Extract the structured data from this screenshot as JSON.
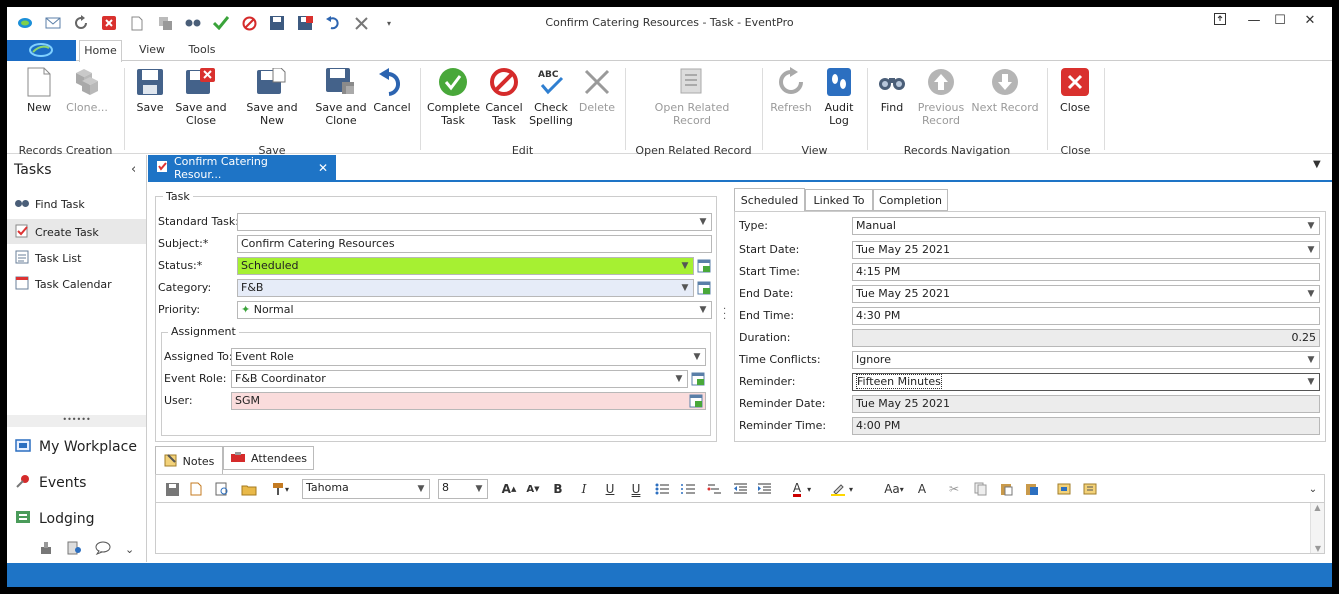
{
  "window": {
    "title": "Confirm Catering Resources - Task - EventPro"
  },
  "ribbon": {
    "tabs": [
      {
        "label": "Home"
      },
      {
        "label": "View"
      },
      {
        "label": "Tools"
      }
    ],
    "buttons": {
      "new": "New",
      "clone": "Clone...",
      "save": "Save",
      "save_close": "Save and\nClose",
      "save_new": "Save and New",
      "save_clone": "Save and\nClone",
      "cancel": "Cancel",
      "complete": "Complete\nTask",
      "cancel_task": "Cancel\nTask",
      "check_spelling": "Check\nSpelling",
      "delete": "Delete",
      "open_related": "Open Related\nRecord",
      "refresh": "Refresh",
      "audit_log": "Audit\nLog",
      "find": "Find",
      "prev_record": "Previous\nRecord",
      "next_record": "Next Record",
      "close": "Close"
    },
    "groups": {
      "records_creation": "Records Creation",
      "save": "Save",
      "edit": "Edit",
      "open_related": "Open Related Record",
      "view": "View",
      "records_navigation": "Records Navigation",
      "close": "Close"
    }
  },
  "sidebar": {
    "title": "Tasks",
    "items": [
      {
        "label": "Find Task"
      },
      {
        "label": "Create Task"
      },
      {
        "label": "Task List"
      },
      {
        "label": "Task Calendar"
      }
    ],
    "sections": [
      {
        "label": "My Workplace"
      },
      {
        "label": "Events"
      },
      {
        "label": "Lodging"
      }
    ]
  },
  "doc_tab": {
    "label": "Confirm Catering Resour..."
  },
  "task": {
    "legend": "Task",
    "standard_task_label": "Standard Task:",
    "standard_task": "",
    "subject_label": "Subject:*",
    "subject": "Confirm Catering Resources",
    "status_label": "Status:*",
    "status": "Scheduled",
    "category_label": "Category:",
    "category": "F&B",
    "priority_label": "Priority:",
    "priority": "Normal",
    "assignment": {
      "legend": "Assignment",
      "assigned_to_label": "Assigned To:",
      "assigned_to": "Event Role",
      "event_role_label": "Event Role:",
      "event_role": "F&B Coordinator",
      "user_label": "User:",
      "user": "SGM"
    }
  },
  "right_tabs": [
    {
      "label": "Scheduled"
    },
    {
      "label": "Linked To"
    },
    {
      "label": "Completion"
    }
  ],
  "schedule": {
    "type_label": "Type:",
    "type": "Manual",
    "start_date_label": "Start Date:",
    "start_date": "Tue May 25 2021",
    "start_time_label": "Start Time:",
    "start_time": "4:15 PM",
    "end_date_label": "End Date:",
    "end_date": "Tue May 25 2021",
    "end_time_label": "End Time:",
    "end_time": "4:30 PM",
    "duration_label": "Duration:",
    "duration": "0.25",
    "conflicts_label": "Time Conflicts:",
    "conflicts": "Ignore",
    "reminder_label": "Reminder:",
    "reminder": "Fifteen Minutes",
    "reminder_date_label": "Reminder Date:",
    "reminder_date": "Tue May 25 2021",
    "reminder_time_label": "Reminder Time:",
    "reminder_time": "4:00 PM"
  },
  "bottom_tabs": [
    {
      "label": "Notes"
    },
    {
      "label": "Attendees"
    }
  ],
  "editor": {
    "font": "Tahoma",
    "size": "8"
  },
  "colors": {
    "accent": "#1e74c6",
    "status_bg": "#a6f032",
    "category_bg": "#e6ecf8",
    "user_bg": "#fadcdc"
  }
}
